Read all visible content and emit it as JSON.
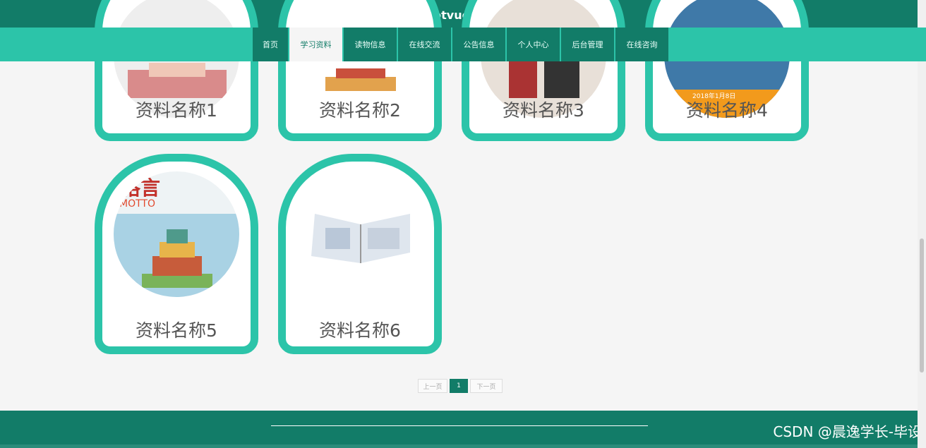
{
  "header": {
    "title": "基于springbootvue小学生学习阅读平台"
  },
  "nav": {
    "items": [
      {
        "label": "首页"
      },
      {
        "label": "学习资料"
      },
      {
        "label": "读物信息"
      },
      {
        "label": "在线交流"
      },
      {
        "label": "公告信息"
      },
      {
        "label": "个人中心"
      },
      {
        "label": "后台管理"
      },
      {
        "label": "在线咨询"
      }
    ],
    "active_index": 1
  },
  "cards": [
    {
      "name": "资料名称1"
    },
    {
      "name": "资料名称2"
    },
    {
      "name": "资料名称3"
    },
    {
      "name": "资料名称4"
    },
    {
      "name": "资料名称5"
    },
    {
      "name": "资料名称6"
    }
  ],
  "cover_texts": {
    "card3_date": "2018年1月8日",
    "card5_title": "格言",
    "card5_subtitle": "MOTTO"
  },
  "pagination": {
    "prev": "上一页",
    "current": "1",
    "next": "下一页"
  },
  "watermark": "CSDN @晨逸学长-毕设",
  "colors": {
    "primary": "#127c68",
    "accent": "#2cc4a9"
  }
}
